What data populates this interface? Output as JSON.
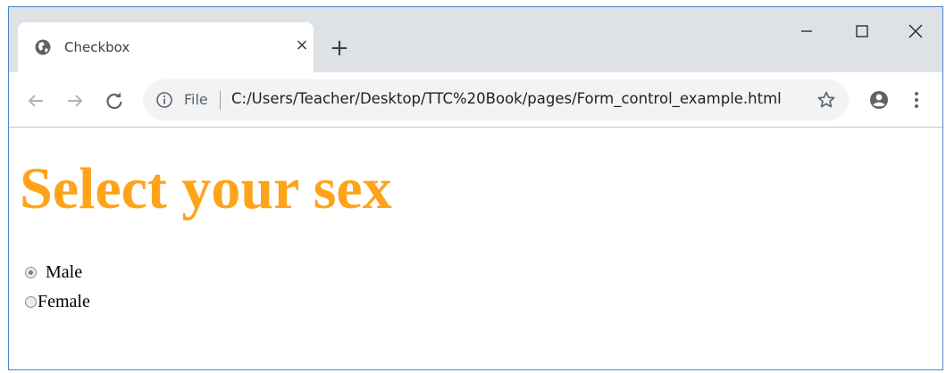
{
  "tab": {
    "title": "Checkbox",
    "close_glyph": "×"
  },
  "new_tab_glyph": "+",
  "window_controls": {
    "minimize": "minimize-icon",
    "maximize": "maximize-icon",
    "close": "close-icon"
  },
  "toolbar": {
    "back_icon": "arrow-left-icon",
    "forward_icon": "arrow-right-icon",
    "reload_icon": "reload-icon",
    "scheme_label": "File",
    "url": "C:/Users/Teacher/Desktop/TTC%20Book/pages/Form_control_example.html",
    "bookmark_icon": "star-icon",
    "profile_icon": "account-icon",
    "menu_icon": "more-vert-icon"
  },
  "page": {
    "heading": "Select your sex",
    "heading_color": "#ffa31a",
    "options": [
      {
        "label": "Male",
        "checked": true
      },
      {
        "label": "Female",
        "checked": false
      }
    ]
  }
}
